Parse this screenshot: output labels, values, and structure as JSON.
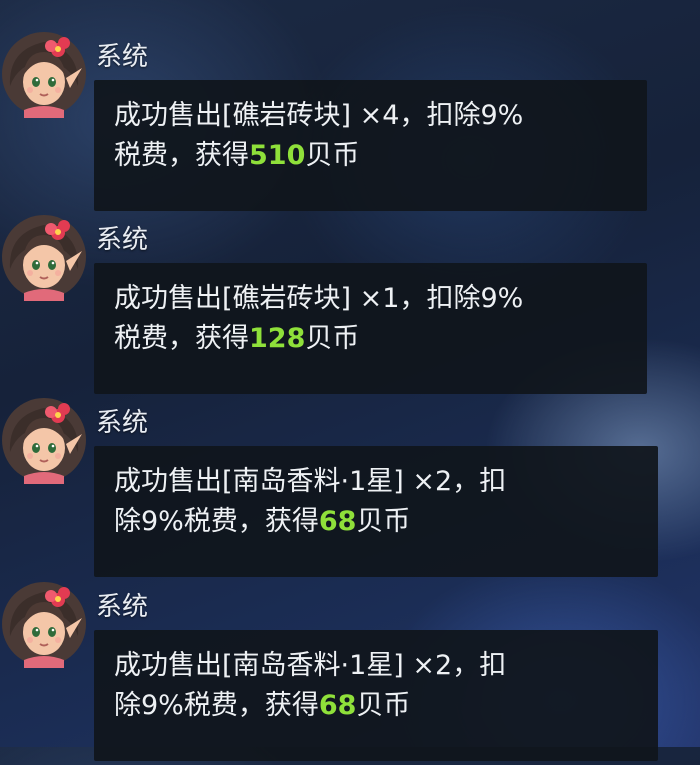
{
  "sender": "系统",
  "messages": [
    {
      "line1": "成功售出[礁岩砖块] ×4，扣除9%",
      "line2_pre": "税费，获得",
      "amount": "510",
      "line2_post": "贝币"
    },
    {
      "line1": "成功售出[礁岩砖块] ×1，扣除9%",
      "line2_pre": "税费，获得",
      "amount": "128",
      "line2_post": "贝币"
    },
    {
      "line1": "成功售出[南岛香料·1星] ×2，扣",
      "line2_pre": "除9%税费，获得",
      "amount": "68",
      "line2_post": "贝币"
    },
    {
      "line1": "成功售出[南岛香料·1星] ×2，扣",
      "line2_pre": "除9%税费，获得",
      "amount": "68",
      "line2_post": "贝币"
    }
  ],
  "colors": {
    "amount_highlight": "#8fe03a",
    "bubble_bg": "#10151c",
    "text": "#eef1f4"
  },
  "icons": {
    "avatar": "girl-with-red-flower-avatar"
  }
}
